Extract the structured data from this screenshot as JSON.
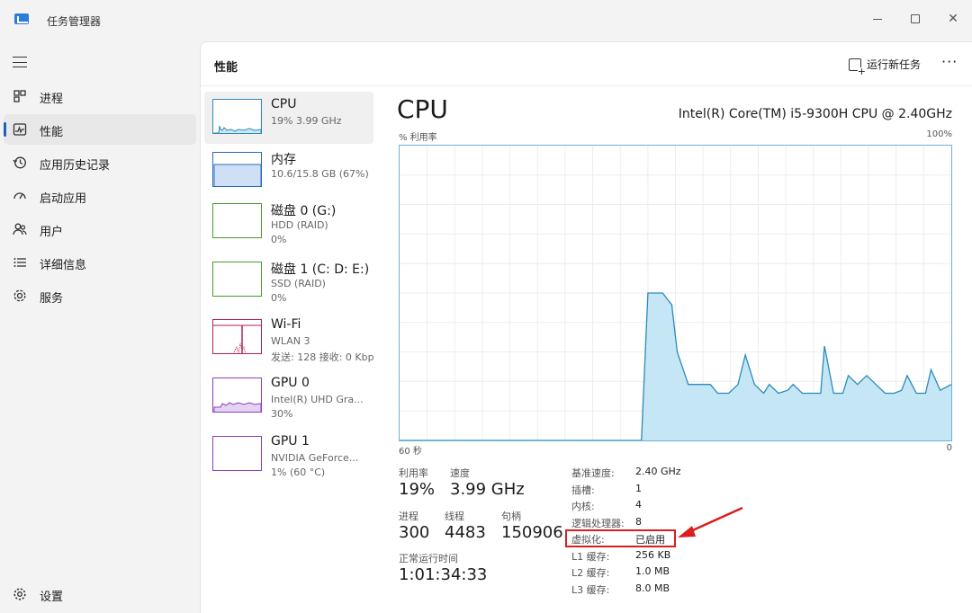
{
  "app": {
    "title": "任务管理器"
  },
  "nav": {
    "items": [
      {
        "label": "进程",
        "icon": "processes-icon"
      },
      {
        "label": "性能",
        "icon": "performance-icon",
        "active": true
      },
      {
        "label": "应用历史记录",
        "icon": "history-icon"
      },
      {
        "label": "启动应用",
        "icon": "startup-icon"
      },
      {
        "label": "用户",
        "icon": "users-icon"
      },
      {
        "label": "详细信息",
        "icon": "details-icon"
      },
      {
        "label": "服务",
        "icon": "services-icon"
      }
    ],
    "settings": "设置"
  },
  "header": {
    "title": "性能",
    "run_task": "运行新任务",
    "more": "···"
  },
  "devices": [
    {
      "name": "CPU",
      "sub": "19%  3.99 GHz",
      "sub2": "",
      "color": "#2b8ab8",
      "fill": "#cde7f3",
      "active": true
    },
    {
      "name": "内存",
      "sub": "10.6/15.8 GB (67%)",
      "sub2": "",
      "color": "#2b68b8",
      "fill": "#cfe0f6"
    },
    {
      "name": "磁盘 0 (G:)",
      "sub": "HDD (RAID)",
      "sub2": "0%",
      "color": "#4a9a2a",
      "fill": "#ffffff"
    },
    {
      "name": "磁盘 1 (C: D: E:)",
      "sub": "SSD (RAID)",
      "sub2": "0%",
      "color": "#4a9a2a",
      "fill": "#ffffff"
    },
    {
      "name": "Wi-Fi",
      "sub": "WLAN 3",
      "sub2": "发送: 128  接收: 0 Kbp",
      "color": "#b3224f",
      "fill": "#ffffff"
    },
    {
      "name": "GPU 0",
      "sub": "Intel(R) UHD Gra...",
      "sub2": "30%",
      "color": "#8a3ec0",
      "fill": "#e4d3f2"
    },
    {
      "name": "GPU 1",
      "sub": "NVIDIA GeForce...",
      "sub2": "1% (60 °C)",
      "color": "#8a3ec0",
      "fill": "#ffffff"
    }
  ],
  "main": {
    "title": "CPU",
    "model": "Intel(R) Core(TM) i5-9300H CPU @ 2.40GHz",
    "y_label": "% 利用率",
    "y_max_label": "100%",
    "x_left_label": "60 秒",
    "x_right_label": "0",
    "line_color": "#2b8ab8",
    "fill_color": "#c4e6f5"
  },
  "chart_data": {
    "type": "area",
    "ylim": [
      0,
      100
    ],
    "xlim": [
      60,
      0
    ],
    "x": [
      60,
      58,
      56,
      54,
      52,
      50,
      48,
      46,
      44,
      42,
      40,
      38,
      36,
      34,
      33.7,
      33,
      31.4,
      30.4,
      29.8,
      28.6,
      27.4,
      26.2,
      25.4,
      24.2,
      23.2,
      22.4,
      21.4,
      20.4,
      19.8,
      18.8,
      17.8,
      17.2,
      16.2,
      15.2,
      14.2,
      13.8,
      12.8,
      11.8,
      11.2,
      10.2,
      9.2,
      8.2,
      7.2,
      6.2,
      5.4,
      4.8,
      3.8,
      2.8,
      2.2,
      1.2,
      0
    ],
    "values": [
      0,
      0,
      0,
      0,
      0,
      0,
      0,
      0,
      0,
      0,
      0,
      0,
      0,
      0,
      0,
      50,
      50,
      46,
      30,
      19,
      19,
      19,
      16,
      16,
      19,
      29,
      19,
      16,
      19,
      16,
      17,
      19,
      16,
      16,
      16,
      32,
      16,
      16,
      22,
      19,
      22,
      19,
      16,
      16,
      17,
      22,
      16,
      16,
      24,
      17,
      19
    ]
  },
  "stats": {
    "util_label": "利用率",
    "util": "19%",
    "speed_label": "速度",
    "speed": "3.99 GHz",
    "proc_label": "进程",
    "proc": "300",
    "threads_label": "线程",
    "threads": "4483",
    "handles_label": "句柄",
    "handles": "150906",
    "uptime_label": "正常运行时间",
    "uptime": "1:01:34:33"
  },
  "specs": [
    {
      "label": "基准速度:",
      "value": "2.40 GHz"
    },
    {
      "label": "插槽:",
      "value": "1"
    },
    {
      "label": "内核:",
      "value": "4"
    },
    {
      "label": "逻辑处理器:",
      "value": "8"
    },
    {
      "label": "虚拟化:",
      "value": "已启用"
    },
    {
      "label": "L1 缓存:",
      "value": "256 KB"
    },
    {
      "label": "L2 缓存:",
      "value": "1.0 MB"
    },
    {
      "label": "L3 缓存:",
      "value": "8.0 MB"
    }
  ],
  "annotation": {
    "color": "#d81e1e"
  }
}
